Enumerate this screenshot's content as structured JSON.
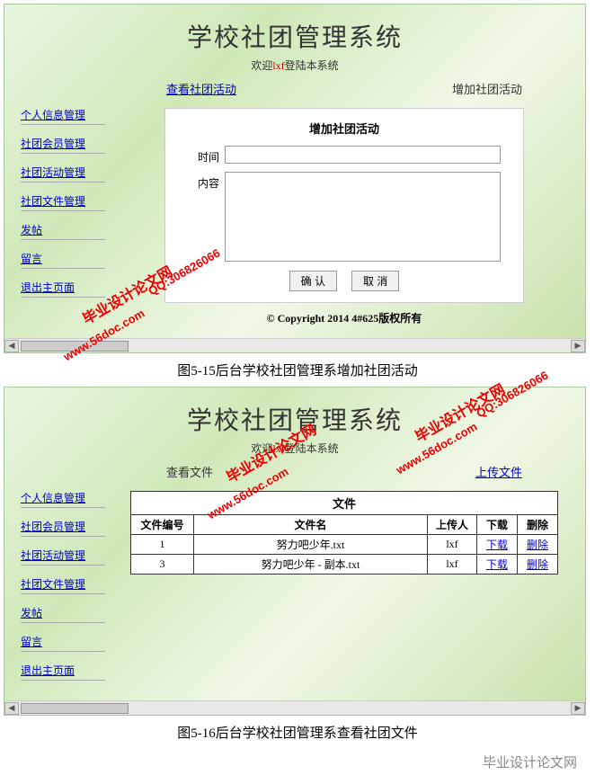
{
  "screenshot1": {
    "title": "学校社团管理系统",
    "welcome_prefix": "欢迎",
    "welcome_user": "lxf",
    "welcome_suffix": "登陆本系统",
    "sidebar": [
      "个人信息管理",
      "社团会员管理",
      "社团活动管理",
      "社团文件管理",
      "发帖",
      "留言",
      "退出主页面"
    ],
    "tab_view": "查看社团活动",
    "tab_add": "增加社团活动",
    "form_title": "增加社团活动",
    "label_time": "时间",
    "label_content": "内容",
    "btn_ok": "确 认",
    "btn_cancel": "取 消",
    "copyright": "© Copyright 2014    4#625版权所有",
    "caption": "图5-15后台学校社团管理系增加社团活动"
  },
  "screenshot2": {
    "title": "学校社团管理系统",
    "welcome_prefix": "欢迎",
    "welcome_user": "lxf",
    "welcome_suffix": "登陆本系统",
    "sidebar": [
      "个人信息管理",
      "社团会员管理",
      "社团活动管理",
      "社团文件管理",
      "发帖",
      "留言",
      "退出主页面"
    ],
    "tab_view": "查看文件",
    "tab_upload": "上传文件",
    "table_title": "文件",
    "table_headers": [
      "文件编号",
      "文件名",
      "上传人",
      "下载",
      "删除"
    ],
    "table_rows": [
      {
        "id": "1",
        "name": "努力吧少年.txt",
        "uploader": "lxf",
        "download": "下载",
        "delete": "删除"
      },
      {
        "id": "3",
        "name": "努力吧少年 - 副本.txt",
        "uploader": "lxf",
        "download": "下载",
        "delete": "删除"
      }
    ],
    "caption": "图5-16后台学校社团管理系查看社团文件"
  },
  "watermark": {
    "text": "毕业设计论文网",
    "url": "www.56doc.com",
    "qq": "QQ:306826066"
  },
  "footer_wm": "毕业设计论文网"
}
